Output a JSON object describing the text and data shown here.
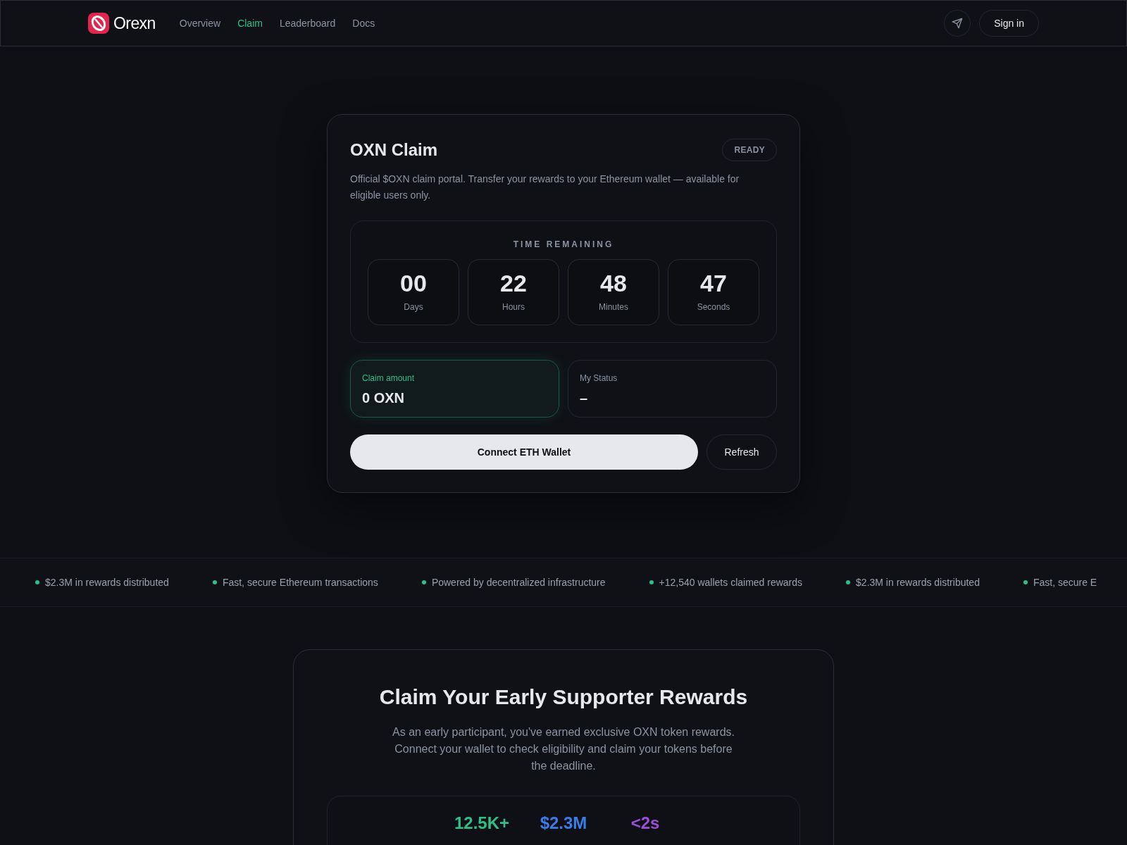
{
  "header": {
    "brand": "Orexn",
    "nav": [
      {
        "label": "Overview",
        "selected": false
      },
      {
        "label": "Claim",
        "selected": true
      },
      {
        "label": "Leaderboard",
        "selected": false
      },
      {
        "label": "Docs",
        "selected": false
      }
    ],
    "sign_in": "Sign in"
  },
  "claim_card": {
    "title": "OXN Claim",
    "badge": "READY",
    "description": "Official $OXN claim portal. Transfer your rewards to your Ethereum wallet — available for eligible users only.",
    "countdown": {
      "title": "TIME REMAINING",
      "units": [
        {
          "value": "00",
          "label": "Days"
        },
        {
          "value": "22",
          "label": "Hours"
        },
        {
          "value": "48",
          "label": "Minutes"
        },
        {
          "value": "47",
          "label": "Seconds"
        }
      ]
    },
    "amount": {
      "label": "Claim amount",
      "value": "0 OXN"
    },
    "status": {
      "label": "My Status",
      "value": "–"
    },
    "connect_button": "Connect ETH Wallet",
    "refresh_button": "Refresh"
  },
  "ticker": [
    "$2.3M in rewards distributed",
    "Fast, secure Ethereum transactions",
    "Powered by decentralized infrastructure",
    "+12,540 wallets claimed rewards",
    "$2.3M in rewards distributed",
    "Fast, secure E"
  ],
  "rewards": {
    "title": "Claim Your Early Supporter Rewards",
    "description": "As an early participant, you've earned exclusive OXN token rewards. Connect your wallet to check eligibility and claim your tokens before the deadline.",
    "stats": [
      {
        "value": "12.5K+",
        "color": "#2fbf87"
      },
      {
        "value": "$2.3M",
        "color": "#3b7de8"
      },
      {
        "value": "<2s",
        "color": "#9b4fd6"
      }
    ]
  }
}
